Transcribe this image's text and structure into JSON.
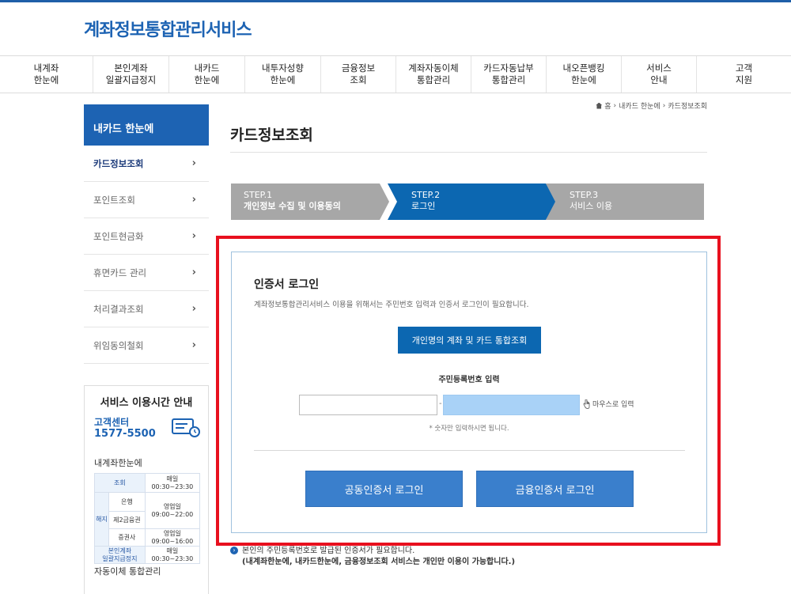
{
  "site": {
    "logo": "계좌정보통합관리서비스"
  },
  "gnb": [
    "내계좌\n한눈에",
    "본인계좌\n일괄지급정지",
    "내카드\n한눈에",
    "내투자성향\n한눈에",
    "금융정보\n조회",
    "계좌자동이체\n통합관리",
    "카드자동납부\n통합관리",
    "내오픈뱅킹\n한눈에",
    "서비스\n안내",
    "고객\n지원"
  ],
  "lnb": {
    "title": "내카드 한눈에",
    "items": [
      "카드정보조회",
      "포인트조회",
      "포인트현금화",
      "휴면카드 관리",
      "처리결과조회",
      "위임동의철회"
    ]
  },
  "service_hours": {
    "title": "서비스 이용시간 안내",
    "cc_label": "고객센터",
    "cc_number": "1577-5500",
    "section1": "내계좌한눈에",
    "section2": "자동이체 통합관리",
    "rows": {
      "inquiry": "조회",
      "inquiry_daily": "매일",
      "inquiry_time": "00:30~23:30",
      "cancel": "해지",
      "bank": "은행",
      "bank_day": "영업일",
      "bank_time": "09:00~22:00",
      "fin2": "제2금융권",
      "sec": "증권사",
      "sec_day": "영업일",
      "sec_time": "09:00~16:00",
      "suspend": "본인계좌\n일괄지급정지",
      "suspend_daily": "매일",
      "suspend_time": "00:30~23:30"
    }
  },
  "breadcrumb": {
    "home": "홈",
    "level1": "내카드 한눈에",
    "level2": "카드정보조회"
  },
  "page_title": "카드정보조회",
  "steps": [
    {
      "no": "STEP.1",
      "text": "개인정보 수집 및 이용동의"
    },
    {
      "no": "STEP.2",
      "text": "로그인"
    },
    {
      "no": "STEP.3",
      "text": "서비스 이용"
    }
  ],
  "login": {
    "title": "인증서 로그인",
    "desc": "계좌정보통합관리서비스 이용을 위해서는 주민번호 입력과 인증서 로그인이 필요합니다.",
    "combined_button": "개인명의 계좌 및 카드 통합조회",
    "ssn_label": "주민등록번호 입력",
    "ssn_dash": "-",
    "mouse_input": "마우스로 입력",
    "ssn_note": "* 숫자만 입력하시면 됩니다.",
    "joint_cert_button": "공동인증서 로그인",
    "fin_cert_button": "금융인증서 로그인"
  },
  "notice": {
    "line1": "본인의 주민등록번호로 발급된 인증서가 필요합니다.",
    "line2": "(내계좌한눈에, 내카드한눈에, 금융정보조회 서비스는 개인만 이용이 가능합니다.)"
  },
  "colors": {
    "brand": "#1d63b3",
    "step_active": "#0c67b1",
    "step_inactive": "#a7a7a7",
    "highlight": "#e8101e"
  }
}
